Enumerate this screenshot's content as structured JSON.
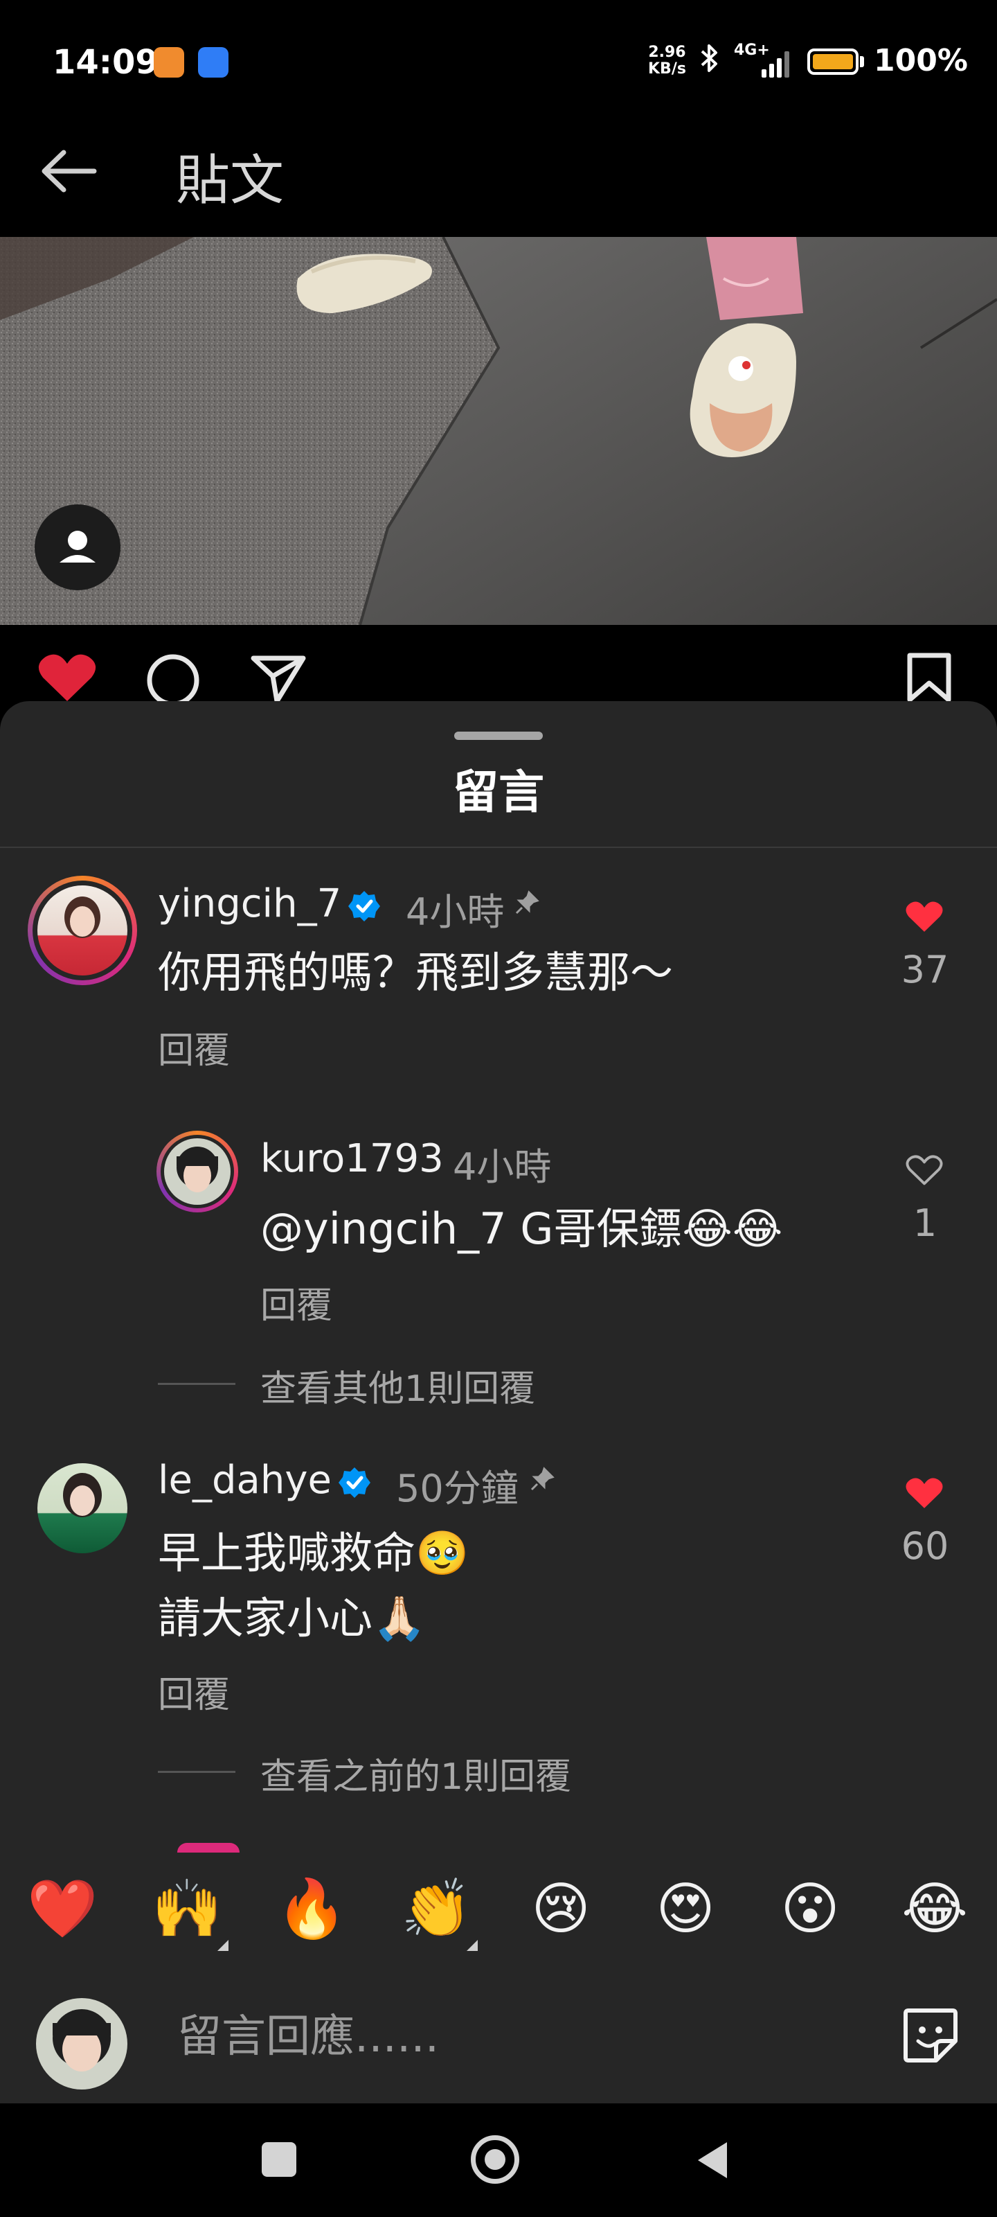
{
  "status_bar": {
    "time": "14:09",
    "net_speed_value": "2.96",
    "net_speed_unit": "KB/s",
    "network": "4G+",
    "battery_percent": "100%",
    "battery_level": 1.0,
    "battery_color": "#f3a81b"
  },
  "header": {
    "title": "貼文",
    "back_icon": "back-arrow-icon"
  },
  "post": {
    "tag_icon": "person-tag-icon",
    "actions": [
      "heart-icon",
      "comment-icon",
      "share-icon",
      "bookmark-icon"
    ],
    "liked": true
  },
  "sheet": {
    "title": "留言"
  },
  "comments": [
    {
      "username": "yingcih_7",
      "verified": true,
      "time": "4小時",
      "pinned": true,
      "text": "你用飛的嗎？飛到多慧那～",
      "reply_label": "回覆",
      "likes": "37",
      "liked": true,
      "replies": [
        {
          "username": "kuro1793",
          "time": "4小時",
          "text": "@yingcih_7 G哥保鏢😂😂",
          "reply_label": "回覆",
          "likes": "1",
          "liked": false
        }
      ],
      "view_more": "查看其他1則回覆"
    },
    {
      "username": "le_dahye",
      "verified": true,
      "time": "50分鐘",
      "pinned": true,
      "text_line1": "早上我喊救命🥹",
      "text_line2": "請大家小心🙏🏻",
      "reply_label": "回覆",
      "likes": "60",
      "liked": true,
      "view_more": "查看之前的1則回覆"
    }
  ],
  "emoji_bar": [
    "❤️",
    "🙌",
    "🔥",
    "👏",
    "😢",
    "😍",
    "😮",
    "😂"
  ],
  "comment_input": {
    "placeholder": "留言回應......"
  },
  "colors": {
    "accent_like": "#ff3040",
    "verified": "#0095f6",
    "sheet_bg": "#262626"
  }
}
